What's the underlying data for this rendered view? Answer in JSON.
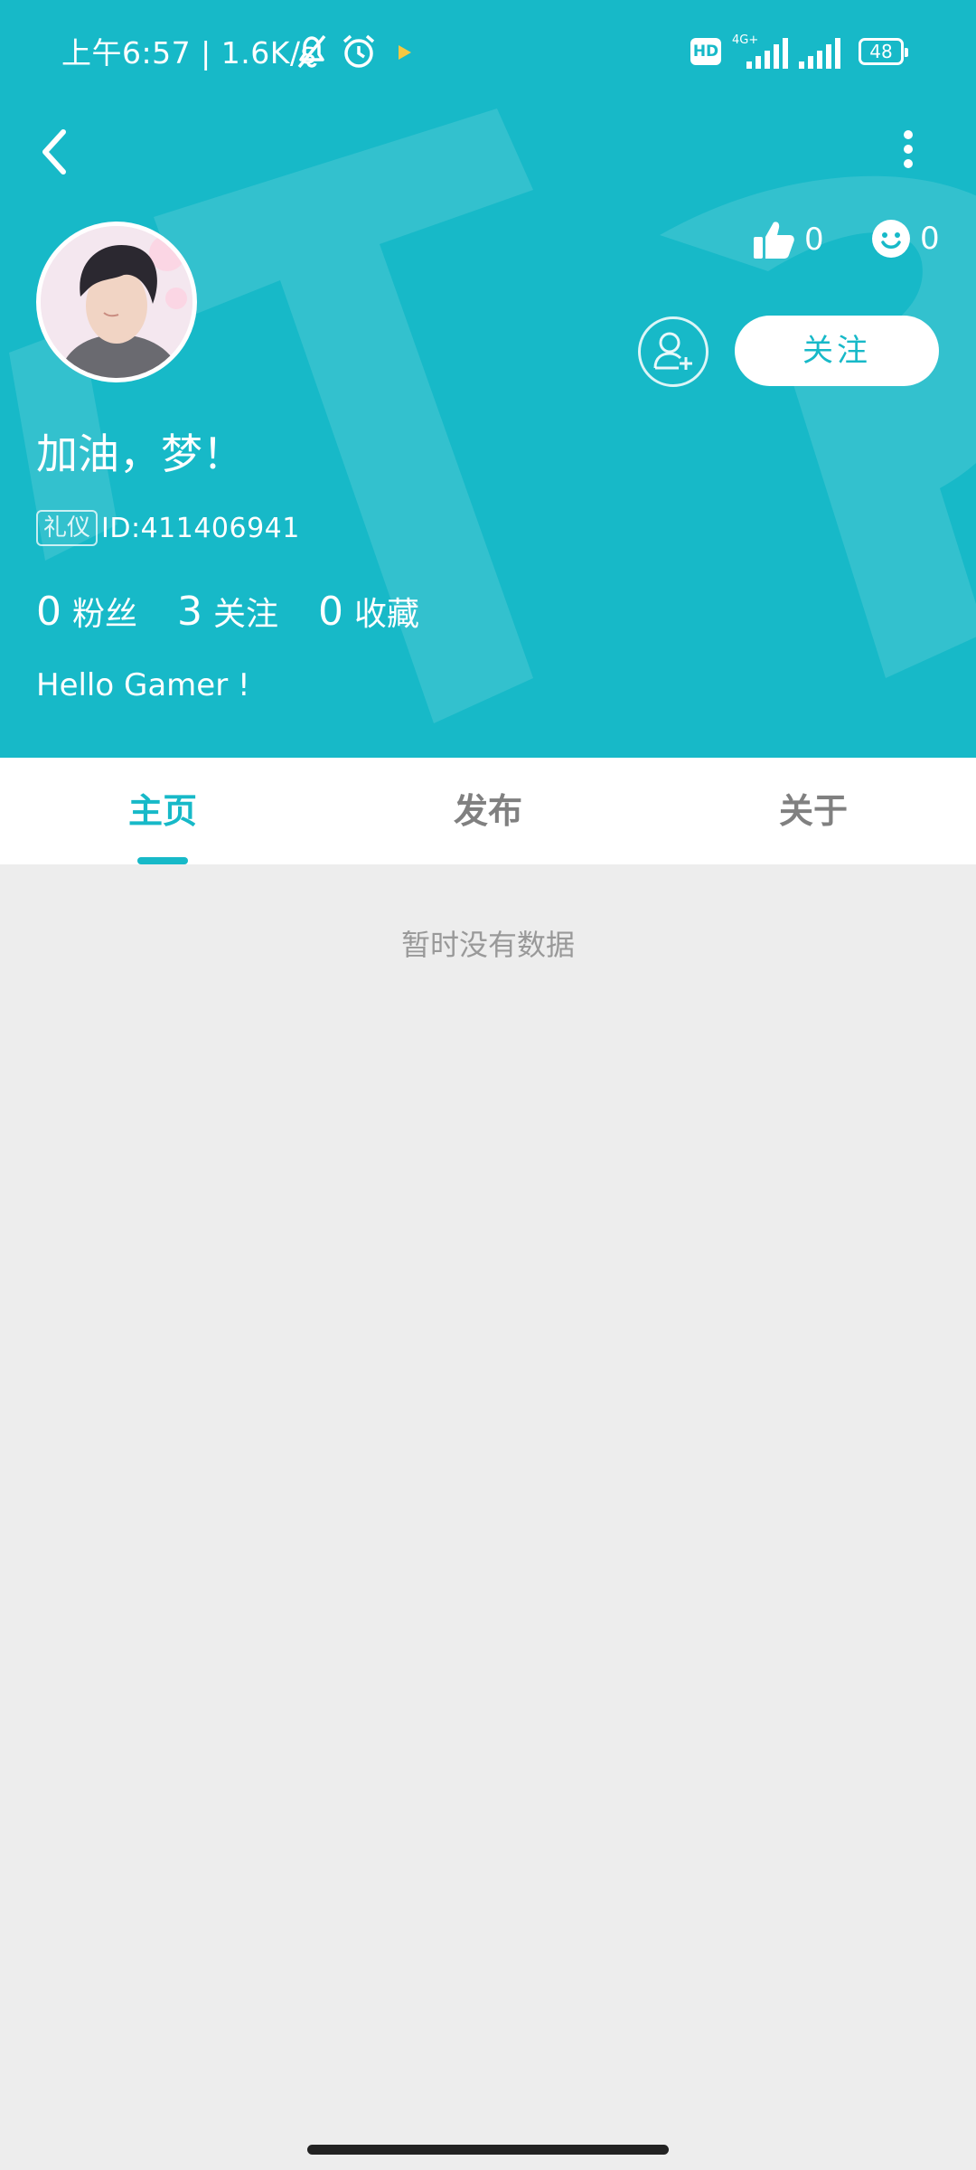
{
  "status_bar": {
    "time": "上午6:57",
    "speed": "1.6K/s",
    "network": "4G+",
    "battery": "48",
    "hd": "HD"
  },
  "profile": {
    "nickname": "加油，梦！",
    "badge": "礼仪",
    "id_label": "ID:411406941",
    "likes": "0",
    "smiles": "0",
    "follow_label": "关注",
    "bio": "Hello Gamer !"
  },
  "counts": [
    {
      "value": "0",
      "label": "粉丝"
    },
    {
      "value": "3",
      "label": "关注"
    },
    {
      "value": "0",
      "label": "收藏"
    }
  ],
  "tabs": [
    {
      "label": "主页",
      "active": true
    },
    {
      "label": "发布",
      "active": false
    },
    {
      "label": "关于",
      "active": false
    }
  ],
  "content": {
    "empty_text": "暂时没有数据"
  },
  "colors": {
    "accent": "#17b9c8",
    "background": "#ededed"
  }
}
